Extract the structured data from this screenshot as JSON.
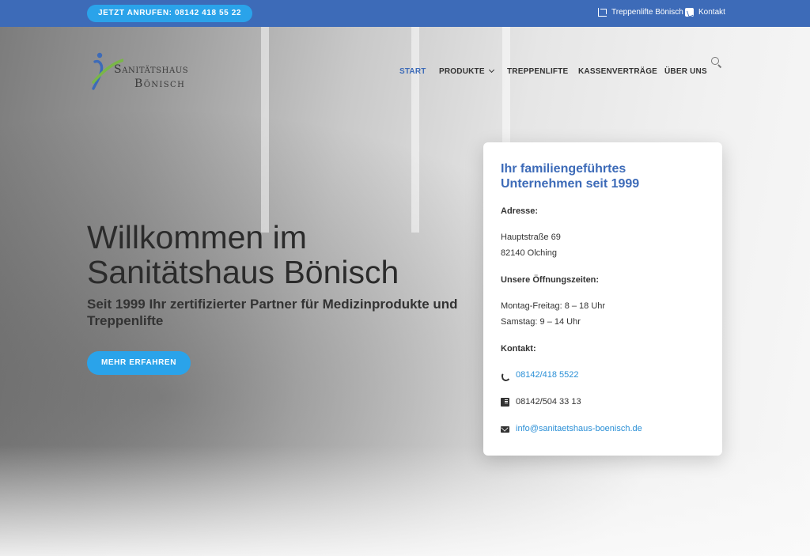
{
  "topbar": {
    "call_label": "JETZT ANRUFEN: 08142 418 55 22",
    "links": [
      {
        "label": "Treppenlifte Bönisch",
        "icon": "stairlift-icon"
      },
      {
        "label": "Kontakt",
        "icon": "phone-square-icon"
      }
    ]
  },
  "brand": {
    "line1": "Sanitätshaus",
    "line2": "Bönisch"
  },
  "nav": {
    "items": [
      {
        "label": "START",
        "active": true
      },
      {
        "label": "PRODUKTE",
        "has_dropdown": true
      },
      {
        "label": "TREPPENLIFTE"
      },
      {
        "label": "KASSENVERTRÄGE"
      },
      {
        "label": "ÜBER UNS"
      }
    ]
  },
  "hero": {
    "title": "Willkommen im Sanitätshaus Bönisch",
    "subtitle": "Seit 1999 Ihr zertifizierter Partner für Medizinprodukte und Treppenlifte",
    "cta_label": "MEHR ERFAHREN"
  },
  "card": {
    "title": "Ihr familiengeführtes Unternehmen seit 1999",
    "address_label": "Adresse:",
    "address_line1": "Hauptstraße 69",
    "address_line2": "82140 Olching",
    "hours_label": "Unsere Öffnungszeiten:",
    "hours_line1": "Montag-Freitag: 8 – 18 Uhr",
    "hours_line2": "Samstag: 9 – 14 Uhr",
    "contact_label": "Kontakt:",
    "phone": "08142/418 5522",
    "fax": "08142/504 33 13",
    "email": "info@sanitaetshaus-boenisch.de"
  },
  "colors": {
    "accent_blue": "#3d6bb8",
    "button_blue": "#2aa3ea",
    "link_blue": "#2a8fd6",
    "logo_green": "#7ab648"
  }
}
